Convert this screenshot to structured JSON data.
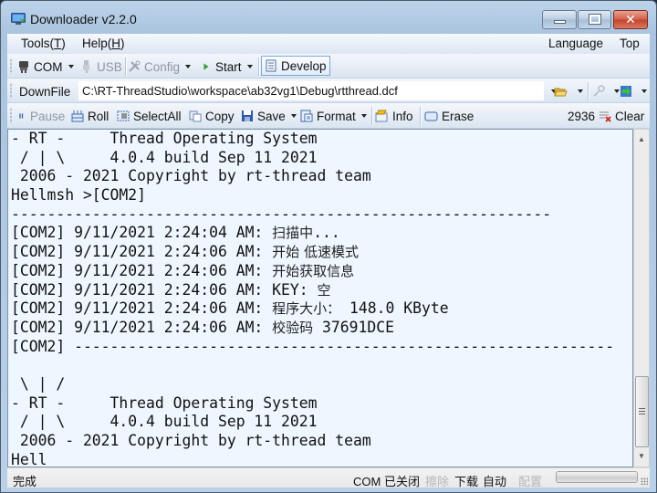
{
  "window": {
    "title": "Downloader v2.2.0",
    "icon": "monitor-download-icon",
    "controls": {
      "minimize": "minimize",
      "maximize": "maximize",
      "close": "close"
    }
  },
  "menubar": {
    "items": [
      {
        "label": "Tools",
        "accel": "T"
      },
      {
        "label": "Help",
        "accel": "H"
      }
    ],
    "right_items": [
      {
        "label": "Language"
      },
      {
        "label": "Top"
      }
    ]
  },
  "toolbar1": {
    "com_label": "COM",
    "usb_label": "USB",
    "config_label": "Config",
    "start_label": "Start",
    "develop_label": "Develop"
  },
  "toolbar2": {
    "downfile_label": "DownFile",
    "path_value": "C:\\RT-ThreadStudio\\workspace\\ab32vg1\\Debug\\rtthread.dcf"
  },
  "toolbar3": {
    "pause_label": "Pause",
    "roll_label": "Roll",
    "selectall_label": "SelectAll",
    "copy_label": "Copy",
    "save_label": "Save",
    "format_label": "Format",
    "info_label": "Info",
    "erase_label": "Erase",
    "count": "2936",
    "clear_label": "Clear"
  },
  "terminal": {
    "lines": [
      {
        "text": "- RT -     Thread Operating System"
      },
      {
        "text": " / | \\     4.0.4 build Sep 11 2021"
      },
      {
        "text": " 2006 - 2021 Copyright by rt-thread team"
      },
      {
        "text": "Hellmsh >[COM2]"
      },
      {
        "text": "------------------------------------------------------------"
      },
      {
        "prefix": "[COM2] 9/11/2021 2:24:04 AM: ",
        "cjk": "扫描中",
        "suffix": "..."
      },
      {
        "prefix": "[COM2] 9/11/2021 2:24:06 AM: ",
        "cjk": "开始 低速模式",
        "suffix": ""
      },
      {
        "prefix": "[COM2] 9/11/2021 2:24:06 AM: ",
        "cjk": "开始获取信息",
        "suffix": ""
      },
      {
        "prefix": "[COM2] 9/11/2021 2:24:06 AM: KEY: ",
        "cjk": "空",
        "suffix": ""
      },
      {
        "prefix": "[COM2] 9/11/2021 2:24:06 AM: ",
        "cjk": "程序大小：",
        "suffix": " 148.0 KByte"
      },
      {
        "prefix": "[COM2] 9/11/2021 2:24:06 AM: ",
        "cjk": "校验码",
        "suffix": " 37691DCE"
      },
      {
        "text": "[COM2] ------------------------------------------------------------"
      },
      {
        "text": ""
      },
      {
        "text": " \\ | /"
      },
      {
        "text": "- RT -     Thread Operating System"
      },
      {
        "text": " / | \\     4.0.4 build Sep 11 2021"
      },
      {
        "text": " 2006 - 2021 Copyright by rt-thread team"
      },
      {
        "text": "Hell"
      }
    ]
  },
  "statusbar": {
    "status": "完成",
    "com_state": "COM 已关闭",
    "erase": "擦除",
    "download": "下载",
    "auto": "自动",
    "config": "配置",
    "progress": 0
  }
}
